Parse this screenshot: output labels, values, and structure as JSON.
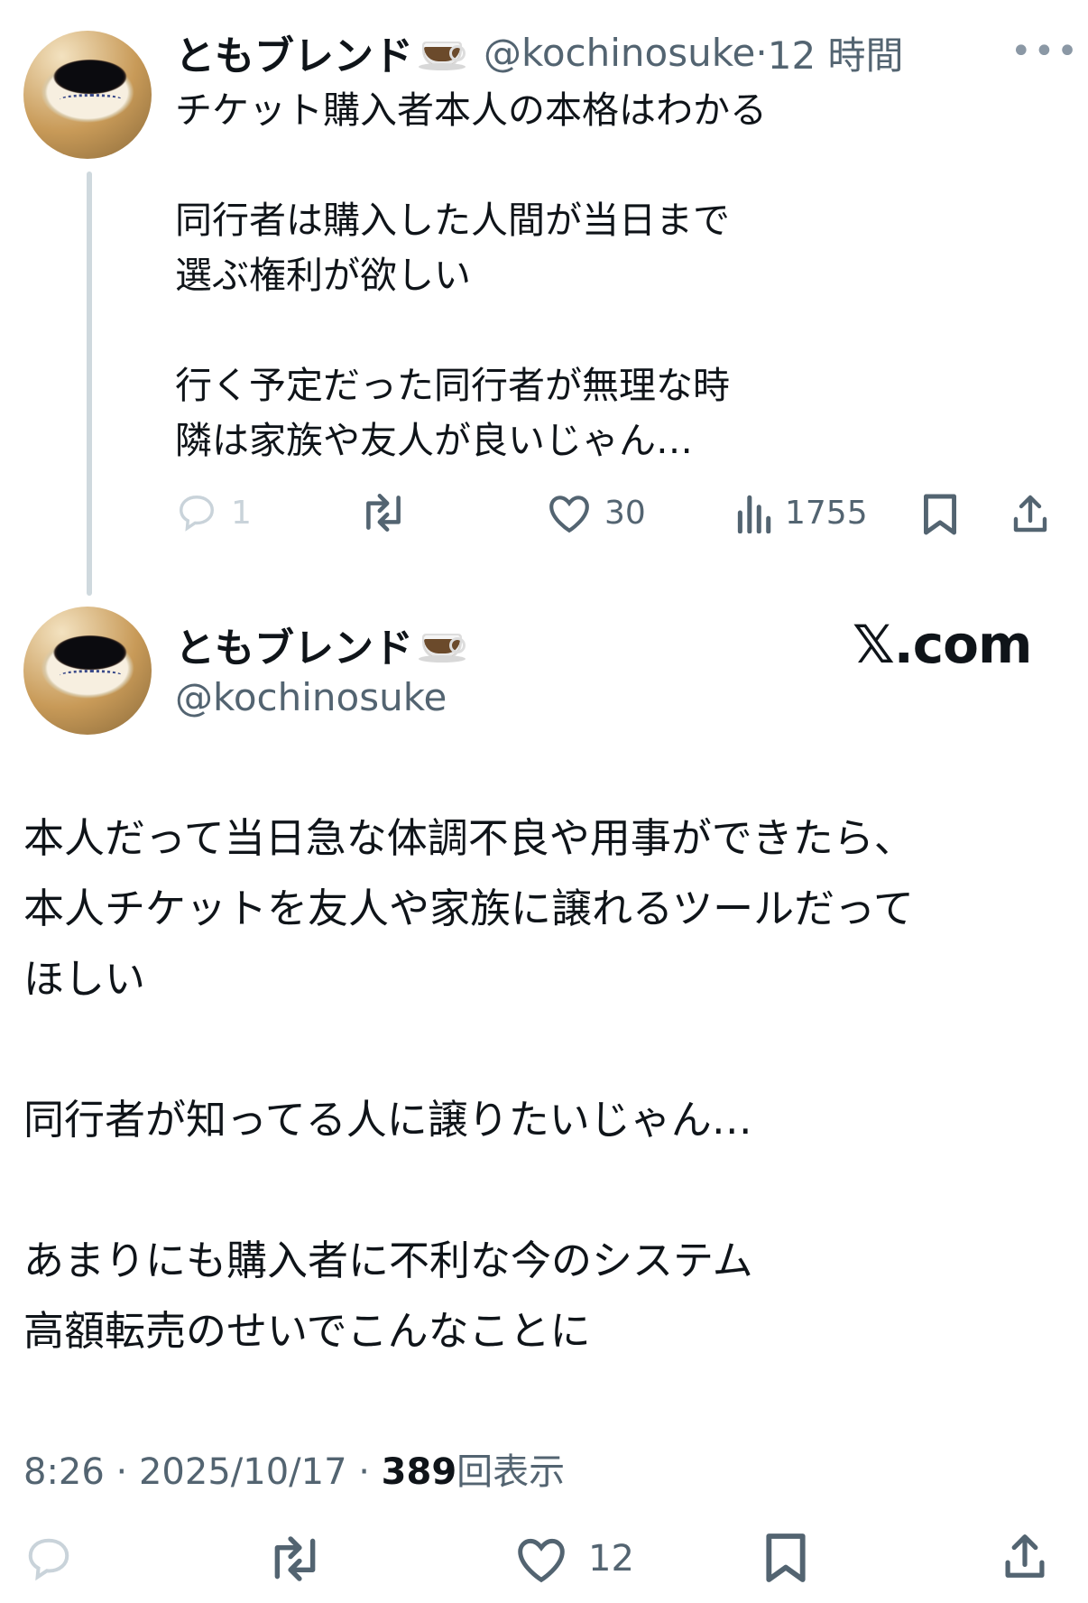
{
  "reply_tweet": {
    "author_name": "ともブレンド",
    "author_handle": "@kochinosuke",
    "time": "12 時間",
    "separator": "·",
    "text": "チケット購入者本人の本格はわかる\n\n同行者は購入した人間が当日まで\n選ぶ権利が欲しい\n\n行く予定だった同行者が無理な時\n隣は家族や友人が良いじゃん…",
    "actions": {
      "reply_count": "1",
      "like_count": "30",
      "view_count": "1755"
    }
  },
  "main_tweet": {
    "author_name": "ともブレンド",
    "author_handle": "@kochinosuke",
    "brand": "𝕏.com",
    "text": "本人だって当日急な体調不良や用事ができたら、\n本人チケットを友人や家族に譲れるツールだって\nほしい\n\n同行者が知ってる人に譲りたいじゃん…\n\nあまりにも購入者に不利な今のシステム\n高額転売のせいでこんなことに",
    "timestamp": "8:26 · 2025/10/17 · ",
    "views_number": "389",
    "views_label": "回表示",
    "actions": {
      "like_count": "12"
    }
  },
  "icons": [
    "reply-icon",
    "retweet-icon",
    "like-icon",
    "views-icon",
    "bookmark-icon",
    "share-icon",
    "more-icon",
    "coffee-icon"
  ]
}
